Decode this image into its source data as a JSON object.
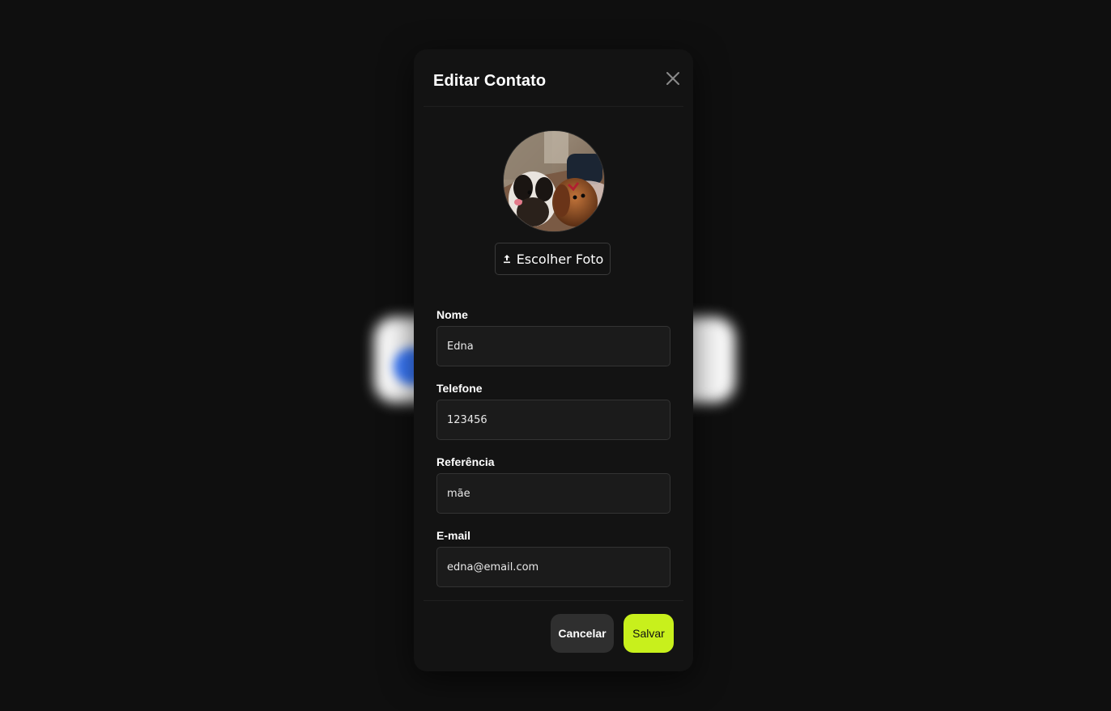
{
  "modal": {
    "title": "Editar Contato",
    "close_icon": "close-icon",
    "upload_icon": "upload-icon",
    "upload_label": "Escolher Foto",
    "avatar_alt": "two dogs photo"
  },
  "form": {
    "nome": {
      "label": "Nome",
      "value": "Edna"
    },
    "telefone": {
      "label": "Telefone",
      "value": "123456"
    },
    "referencia": {
      "label": "Referência",
      "value": "mãe"
    },
    "email": {
      "label": "E-mail",
      "value": "edna@email.com"
    }
  },
  "footer": {
    "cancel_label": "Cancelar",
    "save_label": "Salvar"
  },
  "colors": {
    "accent": "#c8f01c",
    "background": "#0f0f0f",
    "modal": "#131313",
    "input": "#1b1b1b"
  }
}
